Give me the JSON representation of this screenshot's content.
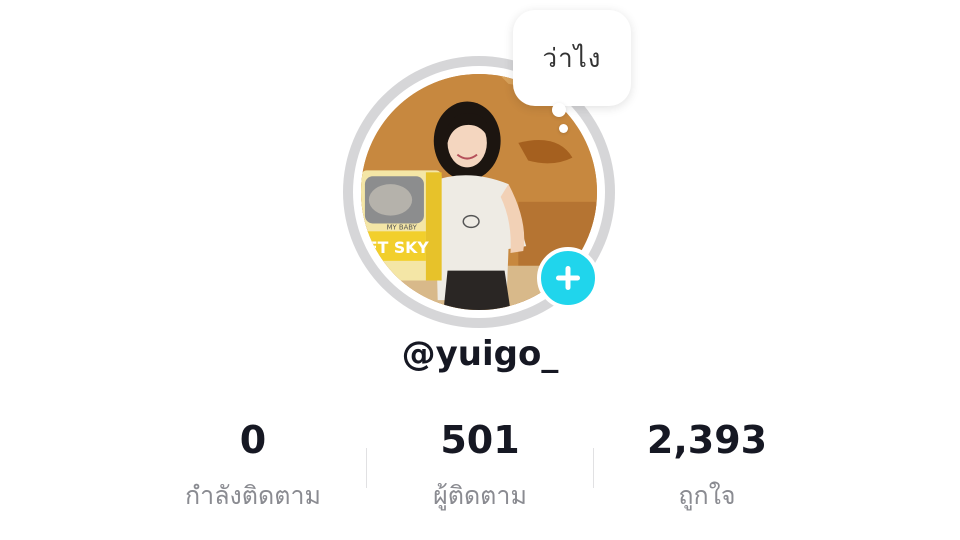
{
  "profile": {
    "username": "@yuigo_",
    "bubble_text": "ว่าไง",
    "accent_color": "#20d5ec",
    "follow_icon": "plus-icon"
  },
  "stats": [
    {
      "value": "0",
      "label": "กำลังติดตาม"
    },
    {
      "value": "501",
      "label": "ผู้ติดตาม"
    },
    {
      "value": "2,393",
      "label": "ถูกใจ"
    }
  ],
  "avatar": {
    "bag_text_top": "MY BABY",
    "bag_text_bottom": "ET SKY"
  }
}
